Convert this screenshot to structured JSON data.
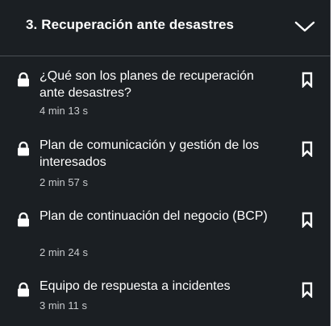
{
  "section": {
    "title": "3. Recuperación ante desastres",
    "expanded": true
  },
  "lessons": [
    {
      "title": "¿Qué son los planes de recuperación ante desastres?",
      "duration": "4 min 13 s",
      "locked": true
    },
    {
      "title": "Plan de comunicación y gestión de los interesados",
      "duration": "2 min 57 s",
      "locked": true
    },
    {
      "title": "Plan de continuación del negocio (BCP)",
      "duration": "2 min 24 s",
      "locked": true
    },
    {
      "title": "Equipo de respuesta a incidentes",
      "duration": "3 min 11 s",
      "locked": true
    }
  ],
  "colors": {
    "background": "#1b1f23",
    "text": "#ffffff",
    "muted_text": "#c9cbce",
    "divider": "#4a4f55"
  },
  "icons": {
    "lock": "lock-icon",
    "bookmark": "bookmark-icon",
    "chevron": "chevron-down-icon"
  }
}
